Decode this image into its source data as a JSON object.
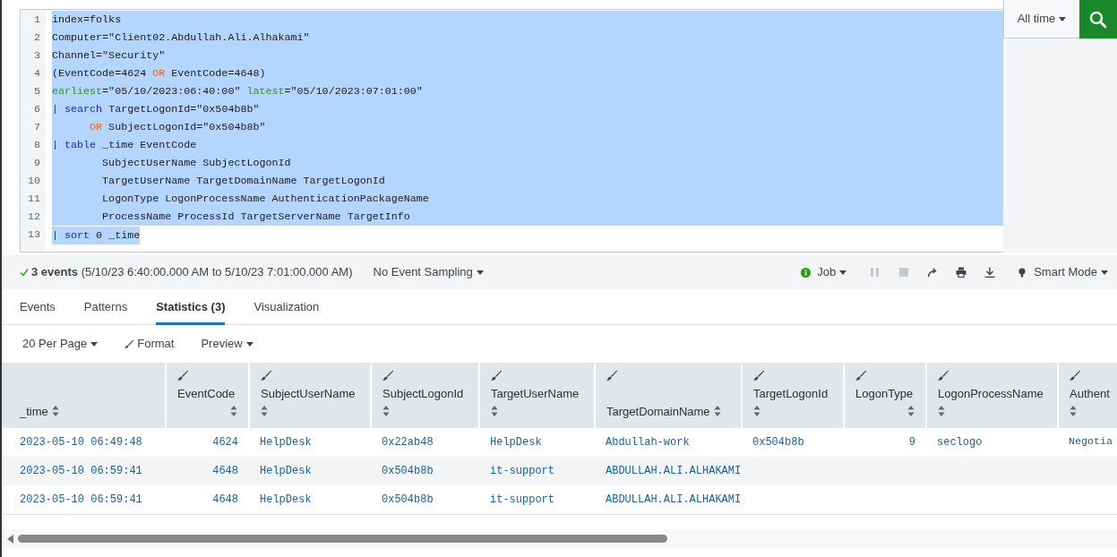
{
  "query": {
    "selected": true,
    "lines": [
      {
        "number": "1",
        "tokens": [
          {
            "text": "index=folks",
            "kind": "plain"
          }
        ]
      },
      {
        "number": "2",
        "tokens": [
          {
            "text": "Computer=\"Client02.Abdullah.Ali.Alhakami\"",
            "kind": "plain"
          }
        ]
      },
      {
        "number": "3",
        "tokens": [
          {
            "text": "Channel=\"Security\"",
            "kind": "plain"
          }
        ]
      },
      {
        "number": "4",
        "tokens": [
          {
            "text": "(EventCode=4624 ",
            "kind": "plain"
          },
          {
            "text": "OR",
            "kind": "operator"
          },
          {
            "text": " EventCode=4648)",
            "kind": "plain"
          }
        ]
      },
      {
        "number": "5",
        "tokens": [
          {
            "text": "earliest",
            "kind": "argument"
          },
          {
            "text": "=\"05/10/2023:06:40:00\" ",
            "kind": "plain"
          },
          {
            "text": "latest",
            "kind": "argument"
          },
          {
            "text": "=\"05/10/2023:07:01:00\"",
            "kind": "plain"
          }
        ]
      },
      {
        "number": "6",
        "tokens": [
          {
            "text": "|",
            "kind": "pipe"
          },
          {
            "text": " search",
            "kind": "command"
          },
          {
            "text": " TargetLogonId=\"0x504b8b\"",
            "kind": "plain"
          }
        ]
      },
      {
        "number": "7",
        "tokens": [
          {
            "text": "      OR",
            "kind": "operator"
          },
          {
            "text": " SubjectLogonId=\"0x504b8b\"",
            "kind": "plain"
          }
        ]
      },
      {
        "number": "8",
        "tokens": [
          {
            "text": "|",
            "kind": "pipe"
          },
          {
            "text": " table",
            "kind": "command"
          },
          {
            "text": " _time EventCode",
            "kind": "plain"
          }
        ]
      },
      {
        "number": "9",
        "tokens": [
          {
            "text": "        SubjectUserName SubjectLogonId",
            "kind": "plain"
          }
        ]
      },
      {
        "number": "10",
        "tokens": [
          {
            "text": "        TargetUserName TargetDomainName TargetLogonId",
            "kind": "plain"
          }
        ]
      },
      {
        "number": "11",
        "tokens": [
          {
            "text": "        LogonType LogonProcessName AuthenticationPackageName",
            "kind": "plain"
          }
        ]
      },
      {
        "number": "12",
        "tokens": [
          {
            "text": "        ProcessName ProcessId TargetServerName TargetInfo",
            "kind": "plain"
          }
        ]
      },
      {
        "number": "13",
        "tokens": [
          {
            "text": "|",
            "kind": "pipe"
          },
          {
            "text": " sort",
            "kind": "command"
          },
          {
            "text": " 0 _time",
            "kind": "plain"
          }
        ]
      }
    ]
  },
  "time_range": {
    "label": "All time"
  },
  "status": {
    "count": "3 events",
    "range": "(5/10/23 6:40:00.000 AM to 5/10/23 7:01:00.000 AM)",
    "sampling": "No Event Sampling",
    "job": "Job",
    "mode": "Smart Mode"
  },
  "job_controls": [
    {
      "kind": "pause",
      "disabled": true
    },
    {
      "kind": "stop",
      "disabled": true
    },
    {
      "kind": "share",
      "disabled": false
    },
    {
      "kind": "print",
      "disabled": false
    },
    {
      "kind": "export",
      "disabled": false
    }
  ],
  "tabs": [
    {
      "label": "Events",
      "selected": false
    },
    {
      "label": "Patterns",
      "selected": false
    },
    {
      "label": "Statistics (3)",
      "selected": true
    },
    {
      "label": "Visualization",
      "selected": false
    }
  ],
  "toolbar": [
    {
      "label": "20 Per Page",
      "kind": "dropdown"
    },
    {
      "label": "Format",
      "kind": "format"
    },
    {
      "label": "Preview",
      "kind": "dropdown"
    }
  ],
  "table": {
    "columns": [
      {
        "label": "_time",
        "kind": "time"
      },
      {
        "label": "EventCode",
        "kind": "number"
      },
      {
        "label": "SubjectUserName",
        "kind": "text"
      },
      {
        "label": "SubjectLogonId",
        "kind": "text"
      },
      {
        "label": "TargetUserName",
        "kind": "text"
      },
      {
        "label": "TargetDomainName",
        "kind": "text"
      },
      {
        "label": "TargetLogonId",
        "kind": "text"
      },
      {
        "label": "LogonType",
        "kind": "number"
      },
      {
        "label": "LogonProcessName",
        "kind": "text"
      },
      {
        "label": "Authent",
        "kind": "text"
      }
    ],
    "rows": [
      [
        "2023-05-10 06:49:48",
        "4624",
        "HelpDesk",
        "0x22ab48",
        "HelpDesk",
        "Abdullah-work",
        "0x504b8b",
        "9",
        "seclogo",
        "Negotia"
      ],
      [
        "2023-05-10 06:59:41",
        "4648",
        "HelpDesk",
        "0x504b8b",
        "it-support",
        "ABDULLAH.ALI.ALHAKAMI"
      ],
      [
        "2023-05-10 06:59:41",
        "4648",
        "HelpDesk",
        "0x504b8b",
        "it-support",
        "ABDULLAH.ALI.ALHAKAMI"
      ]
    ]
  }
}
